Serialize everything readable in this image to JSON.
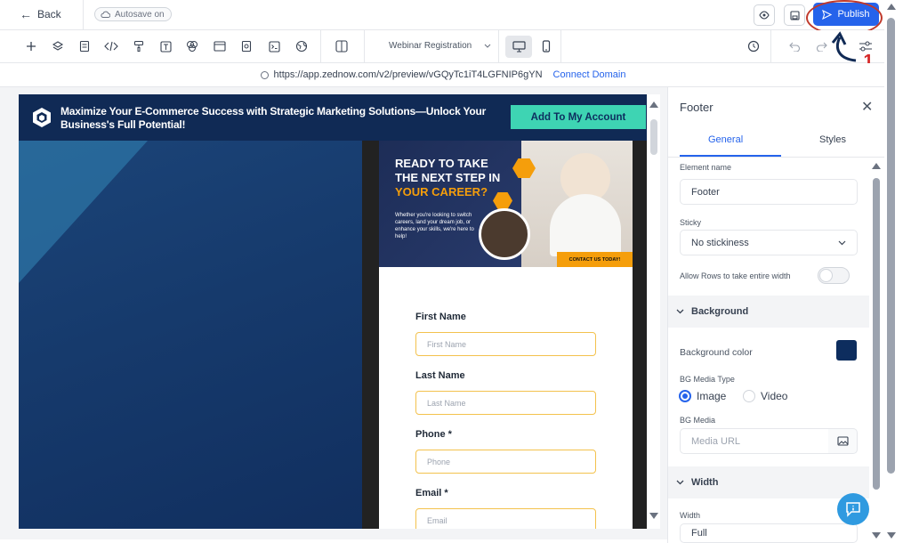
{
  "topbar": {
    "back_label": "Back",
    "autosave_label": "Autosave on",
    "publish_label": "Publish"
  },
  "toolbar": {
    "page_select_value": "Webinar Registration",
    "tools": [
      "add-icon",
      "layers-icon",
      "pages-icon",
      "code-icon",
      "paint-roller-icon",
      "text-icon",
      "color-palette-icon",
      "layout-icon",
      "search-doc-icon",
      "terminal-icon",
      "globe-icon",
      "columns-icon"
    ]
  },
  "urlbar": {
    "url": "https://app.zednow.com/v2/preview/vGQyTc1iT4LGFNIP6gYN",
    "connect_label": "Connect Domain"
  },
  "preview": {
    "headline": "Maximize Your E-Commerce Success with Strategic Marketing Solutions—Unlock Your Business's Full Potential!",
    "cta_label": "Add To My Account",
    "banner": {
      "title_line1": "READY TO TAKE",
      "title_line2": "THE NEXT STEP IN",
      "title_line3": "YOUR CAREER?",
      "subtext": "Whether you're looking to switch careers, land your dream job, or enhance your skills, we're here to help!",
      "contact_label": "CONTACT US TODAY!"
    },
    "form": [
      {
        "label": "First Name",
        "placeholder": "First Name"
      },
      {
        "label": "Last Name",
        "placeholder": "Last Name"
      },
      {
        "label": "Phone *",
        "placeholder": "Phone"
      },
      {
        "label": "Email *",
        "placeholder": "Email"
      }
    ]
  },
  "panel": {
    "title": "Footer",
    "tab_general": "General",
    "tab_styles": "Styles",
    "element_name_label": "Element name",
    "element_name_value": "Footer",
    "sticky_label": "Sticky",
    "sticky_value": "No stickiness",
    "allow_rows_label": "Allow Rows to take entire width",
    "background_section": "Background",
    "bg_color_label": "Background color",
    "bg_color_value": "#0d2d5e",
    "bg_media_type_label": "BG Media Type",
    "radio_image": "Image",
    "radio_video": "Video",
    "bg_media_label": "BG Media",
    "media_url_placeholder": "Media URL",
    "width_section": "Width",
    "width_label": "Width",
    "width_value": "Full"
  },
  "annotation": {
    "number": "1",
    "color": "#d62828"
  }
}
